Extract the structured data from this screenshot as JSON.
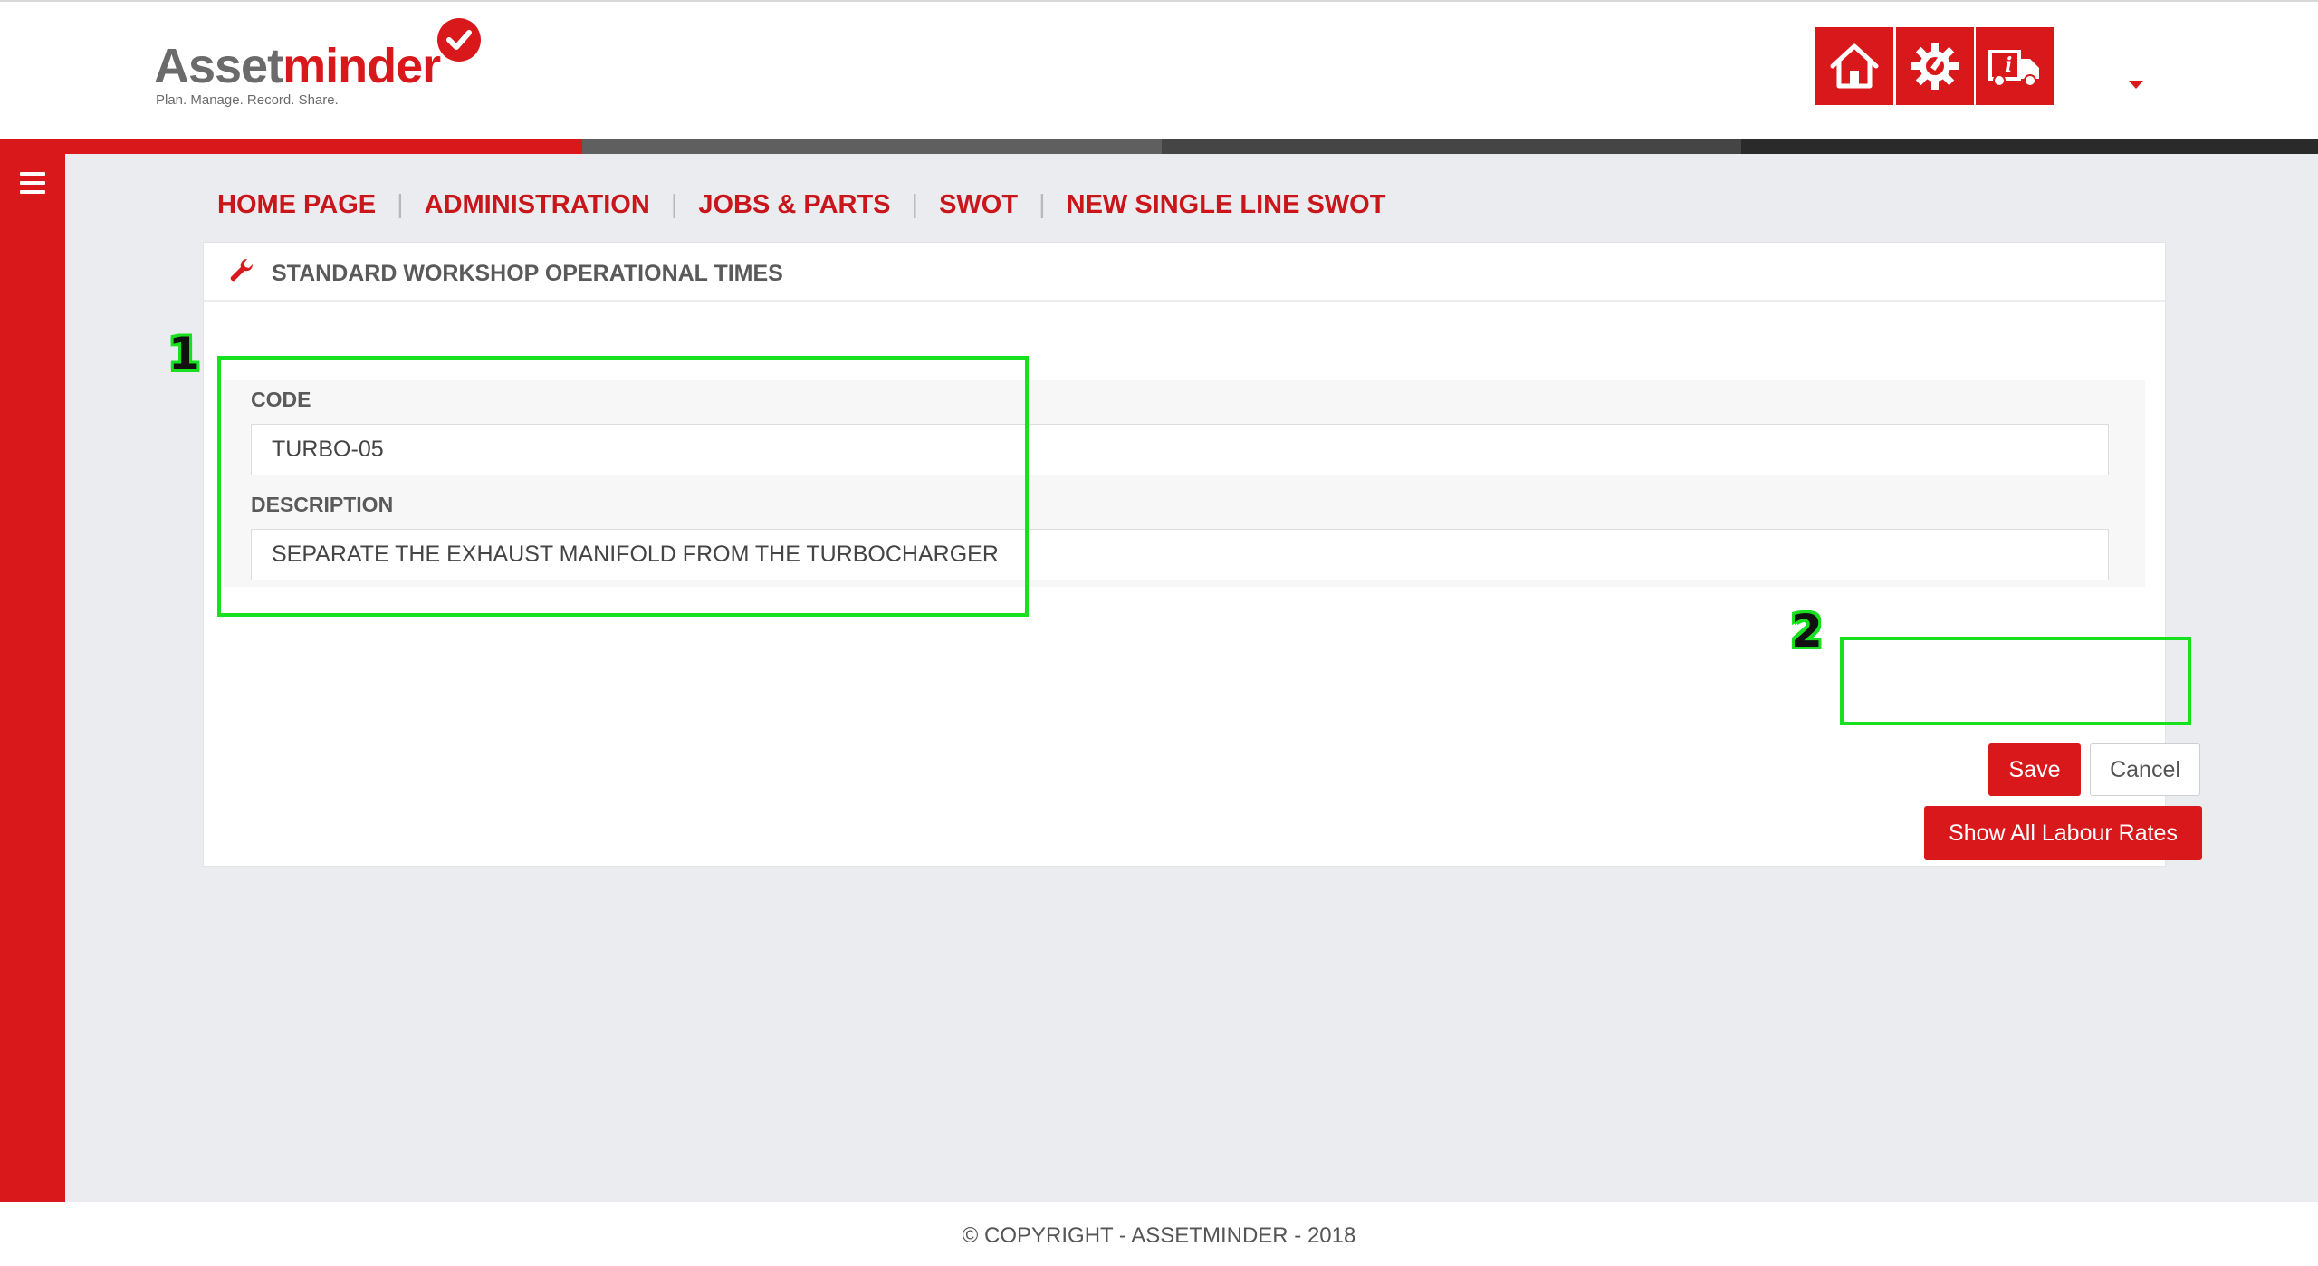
{
  "header": {
    "logo": {
      "word_part1": "Asset",
      "word_part2": "minder",
      "tagline": "Plan. Manage. Record. Share."
    },
    "icons": [
      "home-icon",
      "settings-gear-icon",
      "truck-info-icon"
    ]
  },
  "sidebar": {
    "menu_icon": "hamburger-icon"
  },
  "breadcrumb": {
    "items": [
      "HOME PAGE",
      "ADMINISTRATION",
      "JOBS & PARTS",
      "SWOT",
      "NEW SINGLE LINE SWOT"
    ],
    "separator": "|"
  },
  "panel": {
    "icon": "wrench-icon",
    "title": "STANDARD WORKSHOP OPERATIONAL TIMES"
  },
  "form": {
    "code": {
      "label": "CODE",
      "value": "TURBO-05"
    },
    "description": {
      "label": "DESCRIPTION",
      "value": "SEPARATE THE EXHAUST MANIFOLD FROM THE TURBOCHARGER"
    }
  },
  "buttons": {
    "save": "Save",
    "cancel": "Cancel",
    "labour_rates": "Show All Labour Rates"
  },
  "annotations": {
    "one": "1",
    "two": "2"
  },
  "footer": {
    "copyright": "© COPYRIGHT - ASSETMINDER - 2018"
  },
  "colors": {
    "brand_red": "#d9181c",
    "annotation_green": "#18e01e",
    "background": "#ebecf0"
  }
}
